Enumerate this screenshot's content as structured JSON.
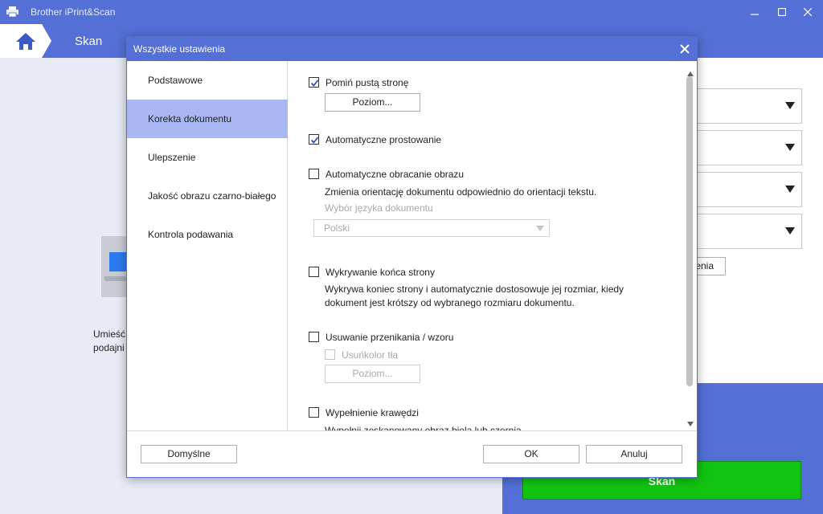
{
  "app": {
    "title": "Brother iPrint&Scan"
  },
  "nav": {
    "title": "Skan"
  },
  "left_pane": {
    "text_line1": "Umieść",
    "text_line2": "podajni"
  },
  "right_pane": {
    "button_label": "enia"
  },
  "main": {
    "scan_button": "Skan"
  },
  "dialog": {
    "title": "Wszystkie ustawienia",
    "nav_items": [
      {
        "label": "Podstawowe",
        "active": false
      },
      {
        "label": "Korekta dokumentu",
        "active": true
      },
      {
        "label": "Ulepszenie",
        "active": false
      },
      {
        "label": "Jakość obrazu czarno-białego",
        "active": false
      },
      {
        "label": "Kontrola podawania",
        "active": false
      }
    ],
    "options": {
      "skip_blank": {
        "label": "Pomiń pustą stronę",
        "checked": true,
        "button": "Poziom..."
      },
      "auto_deskew": {
        "label": "Automatyczne prostowanie",
        "checked": true
      },
      "auto_rotate": {
        "label": "Automatyczne obracanie obrazu",
        "checked": false,
        "description": "Zmienia orientację dokumentu odpowiednio do orientacji tekstu.",
        "language_label": "Wybór języka dokumentu",
        "language_value": "Polski"
      },
      "end_of_page": {
        "label": "Wykrywanie końca strony",
        "checked": false,
        "description_line1": "Wykrywa koniec strony i automatycznie dostosowuje jej rozmiar, kiedy",
        "description_line2": "dokument jest krótszy od wybranego rozmiaru dokumentu."
      },
      "bleed_through": {
        "label": "Usuwanie przenikania / wzoru",
        "checked": false,
        "sub_label": "Usuńkolor tła",
        "button": "Poziom..."
      },
      "edge_fill": {
        "label": "Wypełnienie krawędzi",
        "checked": false,
        "description": "Wypełnij zeskanowany obraz bielą lub czernią"
      }
    },
    "footer": {
      "default_button": "Domyślne",
      "ok_button": "OK",
      "cancel_button": "Anuluj"
    }
  }
}
